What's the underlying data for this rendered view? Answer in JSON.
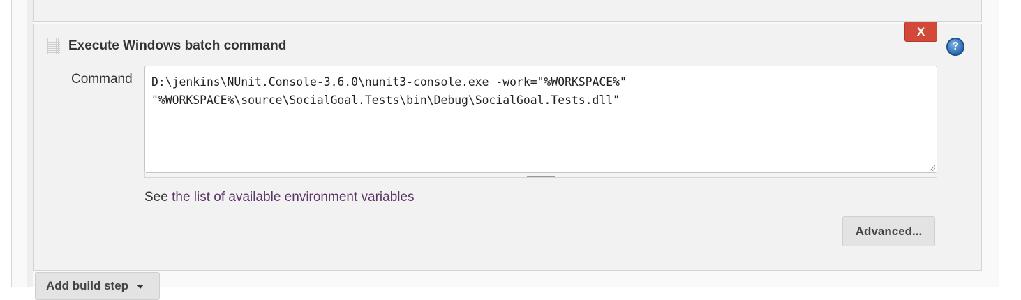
{
  "build_step": {
    "title": "Execute Windows batch command",
    "delete_label": "X",
    "help_symbol": "?",
    "command_label": "Command",
    "command_lines": [
      "D:\\jenkins\\NUnit.Console-3.6.0\\nunit3-console.exe -work=\"%WORKSPACE%\"",
      "\"%WORKSPACE%\\source\\SocialGoal.Tests\\bin\\Debug\\SocialGoal.Tests.dll\""
    ],
    "env_prefix": "See ",
    "env_link": "the list of available environment variables",
    "advanced_label": "Advanced..."
  },
  "footer": {
    "add_build_step_label": "Add build step"
  },
  "colors": {
    "delete_button": "#d24939",
    "link": "#5c3566",
    "panel_bg": "#f2f2f2",
    "button_bg": "#e3e3e3"
  },
  "icons": {
    "drag": "drag-handle-icon",
    "help": "help-icon",
    "caret": "chevron-down-icon"
  }
}
